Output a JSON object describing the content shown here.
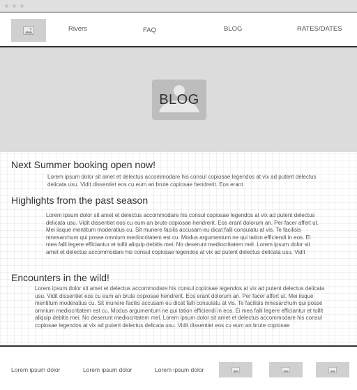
{
  "window": {
    "controls": [
      "close",
      "minimize",
      "maximize"
    ]
  },
  "navbar": {
    "logo_icon": "image-placeholder-icon",
    "links": [
      "Rivers",
      "FAQ",
      "BLOG",
      "RATES/DATES"
    ]
  },
  "hero": {
    "label": "BLOG",
    "icon": "person-image-placeholder-icon"
  },
  "sections": [
    {
      "heading": "Next Summer booking open now!",
      "body": "Lorem ipsum dolor sit amet et delectus accommodare his consul copiosae legendos at vix ad putent delectus delicata usu. Vidit dissentiet eos cu eum an brute copiosae hendrerit. Eos erant"
    },
    {
      "heading": "Highlights from the past season",
      "body": "Lorem ipsum dolor sit amet et delectus accommodare his consul copiosae legendos at vix ad putent delectus delicata usu. Vidit dissentiet eos cu eum an brute copiosae hendrerit. Eos erant dolorum an. Per facer affert ut. Mei iisque mentitum moderatius cu. Sit munere facilis accusam eu dicat falli consulatu at vis. Te facilisis mnesarchum qui posse omnium mediocritatem est cu. Modus argumentum ne qui tation efficiendi in eos. Ei mea falli legere efficiantur et tollit aliquip debitis mei. No deserunt mediocritatem mel. Lorem ipsum dolor sit amet et delectus accommodare his consul copiosae legendos at vix ad putent delectus delicata usu. Vidit"
    },
    {
      "heading": "Encounters in the wild!",
      "body": "Lorem ipsum dolor sit amet et delectus accommodare his consul copiosae legendos at vix ad putent delectus delicata usu. Vidit dissentiet eos cu eum an brute copiosae hendrerit. Eos erant dolorum an. Per facer affert ut. Mei iisque mentitum moderatius cu. Sit munere facilis accusam eu dicat falli consulatu at vis. Te facilisis mnesarchum qui posse omnium mediocritatem est cu. Modus argumentum ne qui tation efficiendi in eos. Ei mea falli legere efficiantur et tollit aliquip debitis mei. No deserunt mediocritatem mel. Lorem ipsum dolor sit amet et delectus accommodare his consul copiosae legendos at vix ad putent delectus delicata usu. Vidit dissentiet eos cu eum an brute copiosae"
    }
  ],
  "footer": {
    "links": [
      "Lorem ipsum dolor",
      "Lorem ipsum dolor",
      "Lorem ipsum dolor"
    ],
    "thumb_icon": "image-placeholder-icon"
  },
  "colors": {
    "hero_bg": "#dcdcdc",
    "placeholder": "#d0d0d0",
    "border": "#333333"
  }
}
